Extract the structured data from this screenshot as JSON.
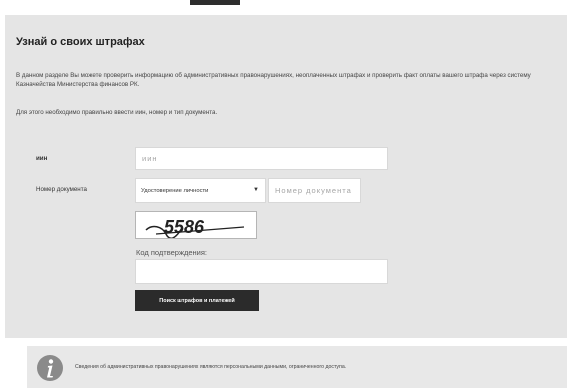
{
  "page": {
    "title": "Узнай о своих штрафах",
    "description": "В данном разделе Вы можете проверить информацию об административных правонарушениях, неоплаченных штрафах и проверить факт оплаты вашего штрафа через систему Казначейства Министерства финансов РК.",
    "hint": "Для этого необходимо правильно ввести иин, номер и тип документа."
  },
  "form": {
    "inn_label": "иин",
    "inn_placeholder": "иин",
    "doc_label": "Номер документа",
    "doc_type_selected": "Удостоверение личности",
    "doc_number_placeholder": "Номер документа",
    "captcha_text": "5586",
    "code_label": "Код подтверждения:",
    "code_value": "",
    "submit_label": "Поиск штрафов и платежей"
  },
  "notice": {
    "text": "Сведения об административных правонарушениях являются персональными данными, ограниченного доступа."
  }
}
